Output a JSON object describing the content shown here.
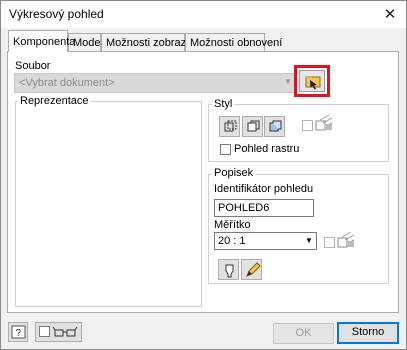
{
  "window": {
    "title": "Výkresový pohled",
    "close_label": "✕"
  },
  "tabs": [
    {
      "label": "Komponenta",
      "active": true
    },
    {
      "label": "Model",
      "active": false
    },
    {
      "label": "Možnosti zobrazení",
      "active": false
    },
    {
      "label": "Možnosti obnovení",
      "active": false
    }
  ],
  "file": {
    "label": "Soubor",
    "placeholder": "<Vybrat dokument>"
  },
  "representations": {
    "label": "Reprezentace"
  },
  "style": {
    "label": "Styl",
    "raster_label": "Pohled rastru",
    "raster_checked": false
  },
  "caption": {
    "label": "Popisek",
    "view_id_label": "Identifikátor pohledu",
    "view_id_value": "POHLED6",
    "scale_label": "Měřítko",
    "scale_value": "20 : 1"
  },
  "footer": {
    "ok_label": "OK",
    "cancel_label": "Storno"
  },
  "icons": [
    "browse-folder-icon",
    "hidden-lines-icon",
    "hidden-lines-removed-icon",
    "shaded-icon",
    "style-from-base-icon",
    "label-visibility-icon",
    "edit-label-icon",
    "help-icon",
    "glasses-preview-icon"
  ],
  "colors": {
    "highlight": "#e0141e",
    "default_button_border": "#0078d7"
  }
}
